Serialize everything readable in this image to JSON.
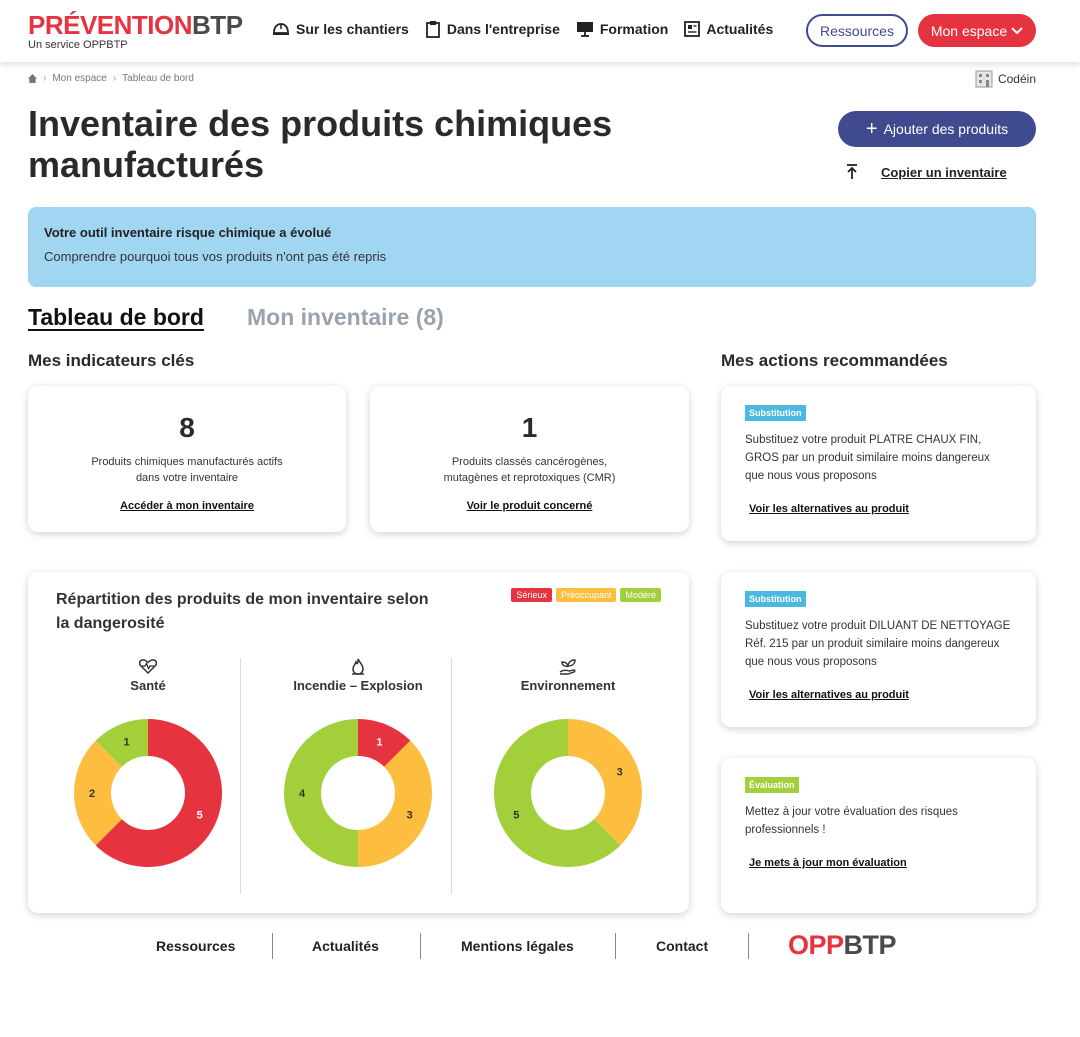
{
  "logo": {
    "part1": "PRÉVENTION",
    "part2": "BTP",
    "subtitle": "Un service OPPBTP"
  },
  "nav": {
    "items": [
      {
        "label": "Sur les chantiers",
        "icon": "hardhat-icon"
      },
      {
        "label": "Dans l'entreprise",
        "icon": "clipboard-icon"
      },
      {
        "label": "Formation",
        "icon": "presentation-icon"
      },
      {
        "label": "Actualités",
        "icon": "newspaper-icon"
      }
    ],
    "resources_button": "Ressources",
    "my_space_button": "Mon espace"
  },
  "breadcrumb": {
    "items": [
      "Mon espace",
      "Tableau de bord"
    ]
  },
  "user": {
    "name": "Codéin"
  },
  "page": {
    "title": "Inventaire des produits chimiques manufacturés",
    "add_button": "Ajouter des produits",
    "copy_link": "Copier un inventaire"
  },
  "banner": {
    "title": "Votre outil inventaire risque chimique a évolué",
    "text": "Comprendre pourquoi tous vos produits n'ont pas été repris"
  },
  "tabs": {
    "dashboard": "Tableau de bord",
    "inventory": "Mon inventaire (8)"
  },
  "indicators": {
    "heading": "Mes indicateurs clés",
    "cards": [
      {
        "value": "8",
        "label_line1": "Produits chimiques manufacturés actifs",
        "label_line2": "dans votre inventaire",
        "link": "Accéder à mon inventaire"
      },
      {
        "value": "1",
        "label_line1": "Produits classés cancérogènes,",
        "label_line2": "mutagènes et reprotoxiques (CMR)",
        "link": "Voir le produit concerné"
      }
    ]
  },
  "distribution": {
    "title": "Répartition des produits de mon inventaire selon la dangerosité",
    "legend": [
      {
        "label": "Sérieux",
        "color": "#e5343f"
      },
      {
        "label": "Préoccupant",
        "color": "#fdbe3f"
      },
      {
        "label": "Modéré",
        "color": "#a2cf3a"
      }
    ]
  },
  "chart_data": [
    {
      "type": "pie",
      "title": "Santé",
      "icon": "heart-pulse-icon",
      "categories": [
        "Sérieux",
        "Préoccupant",
        "Modéré"
      ],
      "values": [
        5,
        2,
        1
      ],
      "colors": [
        "#e5343f",
        "#fdbe3f",
        "#a2cf3a"
      ]
    },
    {
      "type": "pie",
      "title": "Incendie – Explosion",
      "icon": "flame-icon",
      "categories": [
        "Sérieux",
        "Préoccupant",
        "Modéré"
      ],
      "values": [
        1,
        3,
        4
      ],
      "colors": [
        "#e5343f",
        "#fdbe3f",
        "#a2cf3a"
      ]
    },
    {
      "type": "pie",
      "title": "Environnement",
      "icon": "plant-hand-icon",
      "categories": [
        "Préoccupant",
        "Modéré"
      ],
      "values": [
        3,
        5
      ],
      "colors": [
        "#fdbe3f",
        "#a2cf3a"
      ]
    }
  ],
  "actions": {
    "heading": "Mes actions recommandées",
    "items": [
      {
        "tag": "Substitution",
        "tag_color": "#4bb8e0",
        "text": "Substituez votre produit PLATRE CHAUX FIN, GROS par un produit similaire moins dangereux que nous vous proposons",
        "link": "Voir les alternatives au produit"
      },
      {
        "tag": "Substitution",
        "tag_color": "#4bb8e0",
        "text": "Substituez votre produit DILUANT DE NETTOYAGE Réf. 215 par un produit similaire moins dangereux que nous vous proposons",
        "link": "Voir les alternatives au produit"
      },
      {
        "tag": "Évaluation",
        "tag_color": "#a2cf3a",
        "text": "Mettez à jour votre évaluation des risques professionnels !",
        "link": "Je mets à jour mon évaluation"
      }
    ]
  },
  "footer": {
    "links": [
      "Ressources",
      "Actualités",
      "Mentions légales",
      "Contact"
    ],
    "logo_part1": "OPP",
    "logo_part2": "BTP"
  }
}
